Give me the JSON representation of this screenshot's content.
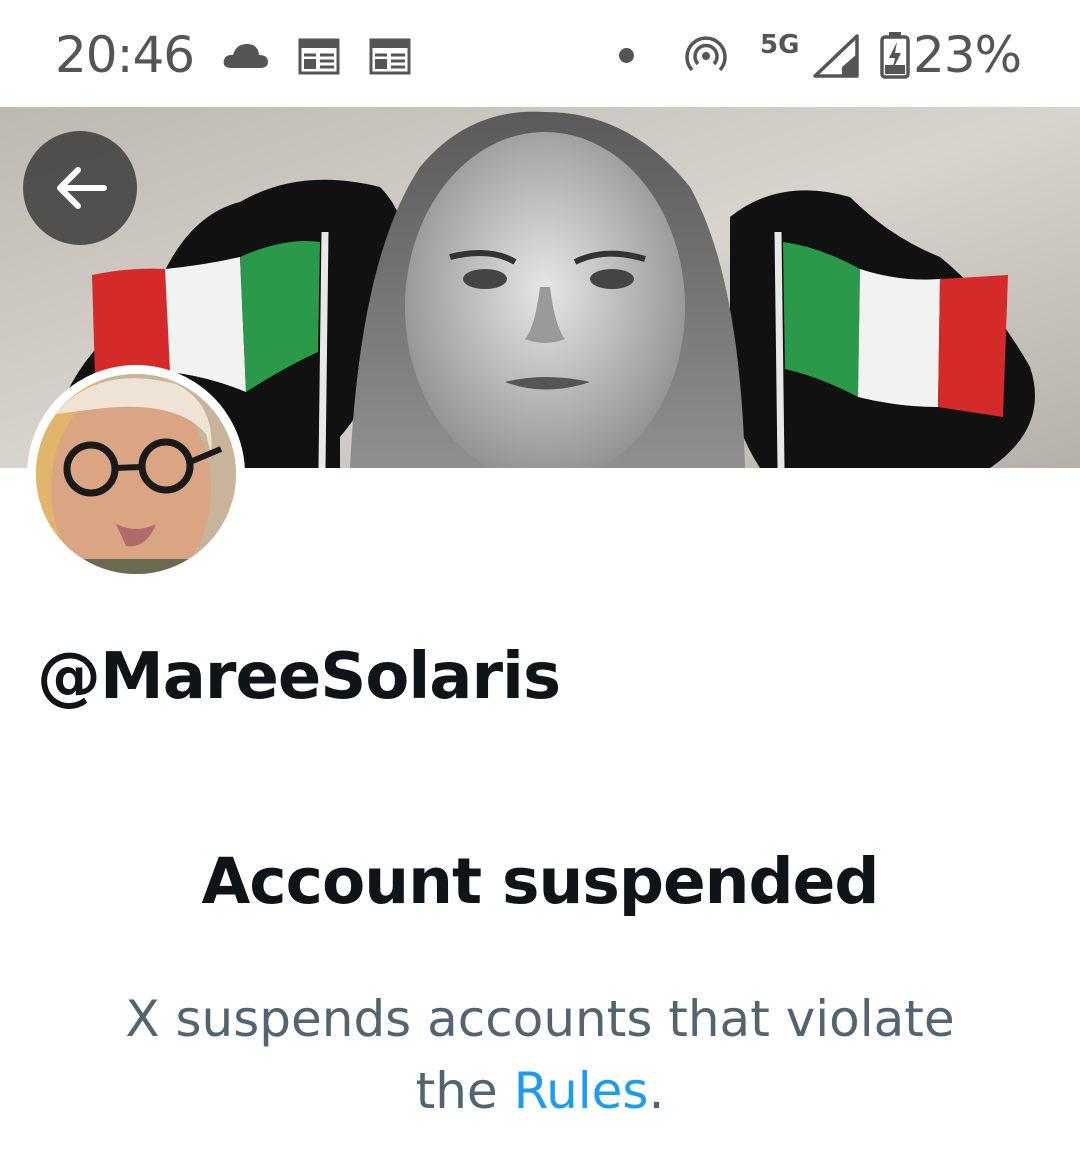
{
  "status_bar": {
    "time": "20:46",
    "network": "5G",
    "battery_percent": "23%",
    "icons": [
      "cloud-icon",
      "calendar-icon",
      "calendar-icon",
      "notification-dot-icon",
      "hotspot-icon",
      "signal-icon",
      "battery-charging-icon"
    ]
  },
  "header": {
    "back_icon": "arrow-left-icon"
  },
  "profile": {
    "handle": "@MareeSolaris"
  },
  "suspension": {
    "title": "Account suspended",
    "message_prefix": "X suspends accounts that violate the ",
    "link_label": "Rules",
    "message_suffix": "."
  },
  "colors": {
    "text_primary": "#0f1419",
    "text_secondary": "#536471",
    "link": "#1d9bf0"
  }
}
